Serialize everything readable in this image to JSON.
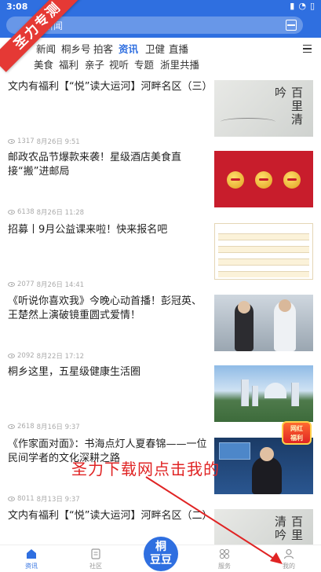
{
  "status_bar": {
    "time": "3:08",
    "icons": [
      "signal-icon",
      "wifi-icon",
      "battery-icon"
    ]
  },
  "search": {
    "placeholder": "新闻"
  },
  "promo_badge": "圣力专测",
  "tabs_primary": [
    {
      "label": "新闻",
      "active": false
    },
    {
      "label": "桐乡号",
      "active": false
    },
    {
      "label": "拍客",
      "active": false
    },
    {
      "label": "资讯",
      "active": true
    },
    {
      "label": "卫健",
      "active": false
    },
    {
      "label": "直播",
      "active": false
    }
  ],
  "tabs_secondary": [
    {
      "label": "美食"
    },
    {
      "label": "福利"
    },
    {
      "label": "亲子"
    },
    {
      "label": "视听"
    },
    {
      "label": "专题"
    },
    {
      "label": "浙里共播"
    }
  ],
  "news": [
    {
      "title": "文内有福利【“悦”读大运河】河畔名区（三）",
      "views": "1317",
      "date": "8月26日 9:51",
      "thumb": "paper",
      "thumb_text": "百里清吟"
    },
    {
      "title": "邮政农品节爆款来袭！星级酒店美食直接“搬”进邮局",
      "views": "6138",
      "date": "8月26日 11:28",
      "thumb": "red"
    },
    {
      "title": "招募丨9月公益课来啦！快来报名吧",
      "views": "2077",
      "date": "8月26日 14:41",
      "thumb": "table"
    },
    {
      "title": "《听说你喜欢我》今晚心动首播！彭冠英、王楚然上演破镜重圆式爱情！",
      "views": "2092",
      "date": "8月22日 17:12",
      "thumb": "people"
    },
    {
      "title": "桐乡这里，五星级健康生活圈",
      "views": "2618",
      "date": "8月16日 9:37",
      "thumb": "city"
    },
    {
      "title": "《作家面对面》：书海点灯人夏春锦——一位民间学者的文化深耕之路",
      "views": "8011",
      "date": "8月13日 9:37",
      "thumb": "studio"
    },
    {
      "title": "文内有福利【“悦”读大运河】河畔名区（二）",
      "views": "",
      "date": "",
      "thumb": "paper",
      "thumb_text": "百里清吟"
    }
  ],
  "float_badge": "网红\n福利",
  "overlay": {
    "text": "圣力下载网点击我的",
    "color": "#e02424"
  },
  "center_logo": "桐\n豆豆",
  "bottom_nav": [
    {
      "label": "资讯",
      "icon": "home-icon",
      "active": true
    },
    {
      "label": "社区",
      "icon": "community-icon",
      "active": false
    },
    {
      "label": "服务",
      "icon": "services-icon",
      "active": false
    },
    {
      "label": "我的",
      "icon": "user-icon",
      "active": false
    }
  ],
  "colors": {
    "accent": "#2f6fe0",
    "badge_red": "#e53935"
  }
}
